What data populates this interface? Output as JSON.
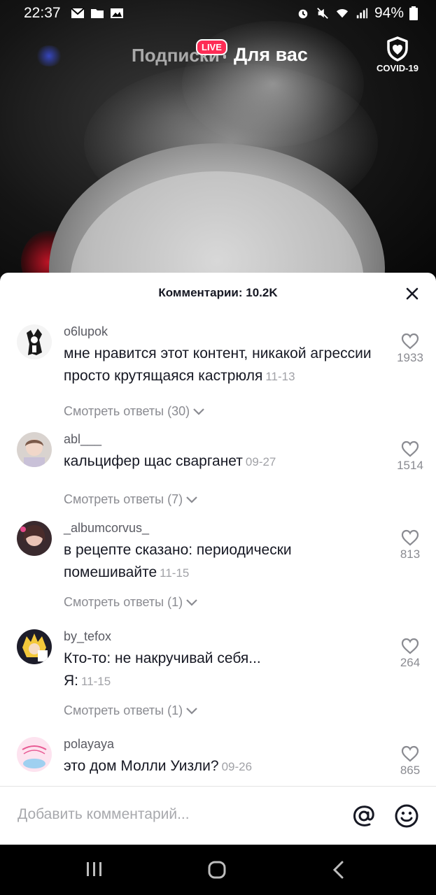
{
  "status_bar": {
    "time": "22:37",
    "battery": "94%"
  },
  "top_nav": {
    "following_tab": "Подписки",
    "live_badge": "LIVE",
    "for_you_tab": "Для вас",
    "covid_label": "COVID-19"
  },
  "comments_panel": {
    "title": "Комментарии: 10.2K",
    "items": [
      {
        "username": "o6lupok",
        "text": "мне нравится этот контент, никакой агрессии просто крутящаяся кастрюля",
        "date": "11-13",
        "likes": "1933",
        "replies": "Смотреть ответы (30)"
      },
      {
        "username": "abl___",
        "text": "кальцифер щас сварганет",
        "date": "09-27",
        "likes": "1514",
        "replies": "Смотреть ответы (7)"
      },
      {
        "username": "_albumcorvus_",
        "text": "в рецепте сказано: периодически помешивайте",
        "date": "11-15",
        "likes": "813",
        "replies": "Смотреть ответы (1)"
      },
      {
        "username": "by_tefox",
        "text_line1": "Кто-то: не накручивай себя...",
        "text_line2": "Я:",
        "date": "11-15",
        "likes": "264",
        "replies": "Смотреть ответы (1)"
      },
      {
        "username": "polayaya",
        "text": "это дом Молли Уизли?",
        "date": "09-26",
        "likes": "865"
      }
    ],
    "input_placeholder": "Добавить комментарий..."
  },
  "colors": {
    "live_badge": "#fe2c55",
    "username": "#5a5b63",
    "secondary_text": "#8a8b91"
  }
}
